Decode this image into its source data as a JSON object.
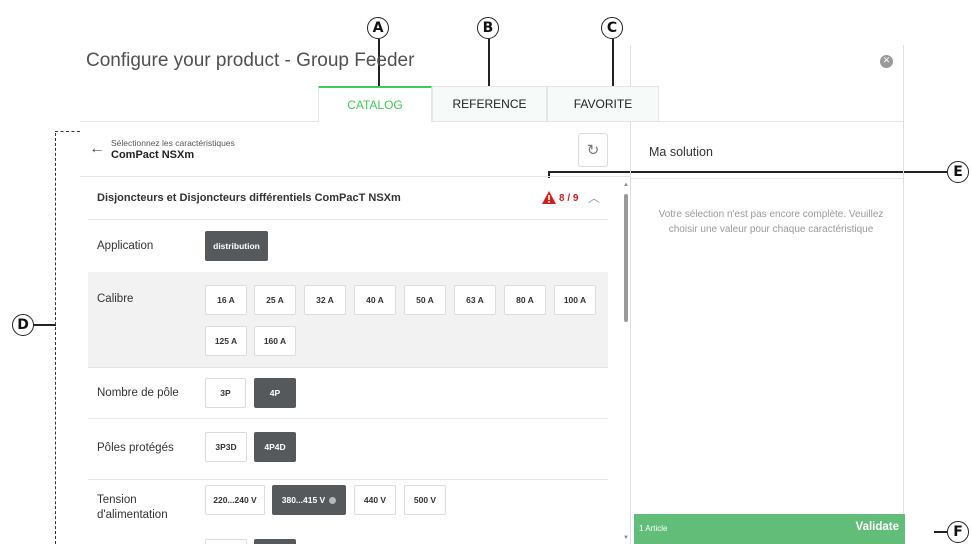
{
  "header": {
    "title": "Configure your product - Group Feeder",
    "close_icon": "close-circle-icon"
  },
  "tabs": [
    {
      "label": "CATALOG",
      "active": true
    },
    {
      "label": "REFERENCE",
      "active": false
    },
    {
      "label": "FAVORITE",
      "active": false
    }
  ],
  "left_panel": {
    "back_icon": "arrow-left-icon",
    "subtitle": "Sélectionnez les caractéristiques",
    "product": "ComPact NSXm",
    "refresh_icon": "refresh-icon"
  },
  "section": {
    "title": "Disjoncteurs et Disjoncteurs différentiels ComPacT NSXm",
    "warning_count": "8 / 9",
    "warning_color": "#d0201a"
  },
  "rows": [
    {
      "label": "Application",
      "options": [
        {
          "text": "distribution",
          "selected": true
        }
      ]
    },
    {
      "label": "Calibre",
      "options": [
        {
          "text": "16 A",
          "selected": false
        },
        {
          "text": "25 A",
          "selected": false
        },
        {
          "text": "32 A",
          "selected": false
        },
        {
          "text": "40 A",
          "selected": false
        },
        {
          "text": "50 A",
          "selected": false
        },
        {
          "text": "63 A",
          "selected": false
        },
        {
          "text": "80 A",
          "selected": false
        },
        {
          "text": "100 A",
          "selected": false
        },
        {
          "text": "125 A",
          "selected": false
        },
        {
          "text": "160 A",
          "selected": false
        }
      ]
    },
    {
      "label": "Nombre de pôle",
      "options": [
        {
          "text": "3P",
          "selected": false
        },
        {
          "text": "4P",
          "selected": true
        }
      ]
    },
    {
      "label": "Pôles protégés",
      "options": [
        {
          "text": "3P3D",
          "selected": false
        },
        {
          "text": "4P4D",
          "selected": true
        }
      ]
    },
    {
      "label": "Tension d'alimentation",
      "options": [
        {
          "text": "220...240 V",
          "selected": false
        },
        {
          "text": "380...415 V",
          "selected": true
        },
        {
          "text": "440 V",
          "selected": false
        },
        {
          "text": "500 V",
          "selected": false
        }
      ]
    }
  ],
  "right_panel": {
    "title": "Ma solution",
    "message": "Votre sélection n'est pas encore complète. Veuillez choisir une valeur pour chaque caractéristique",
    "footer_count": "1 Article",
    "footer_action": "Validate",
    "accent": "#62bd79"
  },
  "callouts": {
    "a": "A",
    "b": "B",
    "c": "C",
    "d": "D",
    "e": "E",
    "f": "F"
  },
  "colors": {
    "brand_green": "#3dcd58",
    "selected_chip": "#55595c",
    "warning": "#d0201a"
  }
}
